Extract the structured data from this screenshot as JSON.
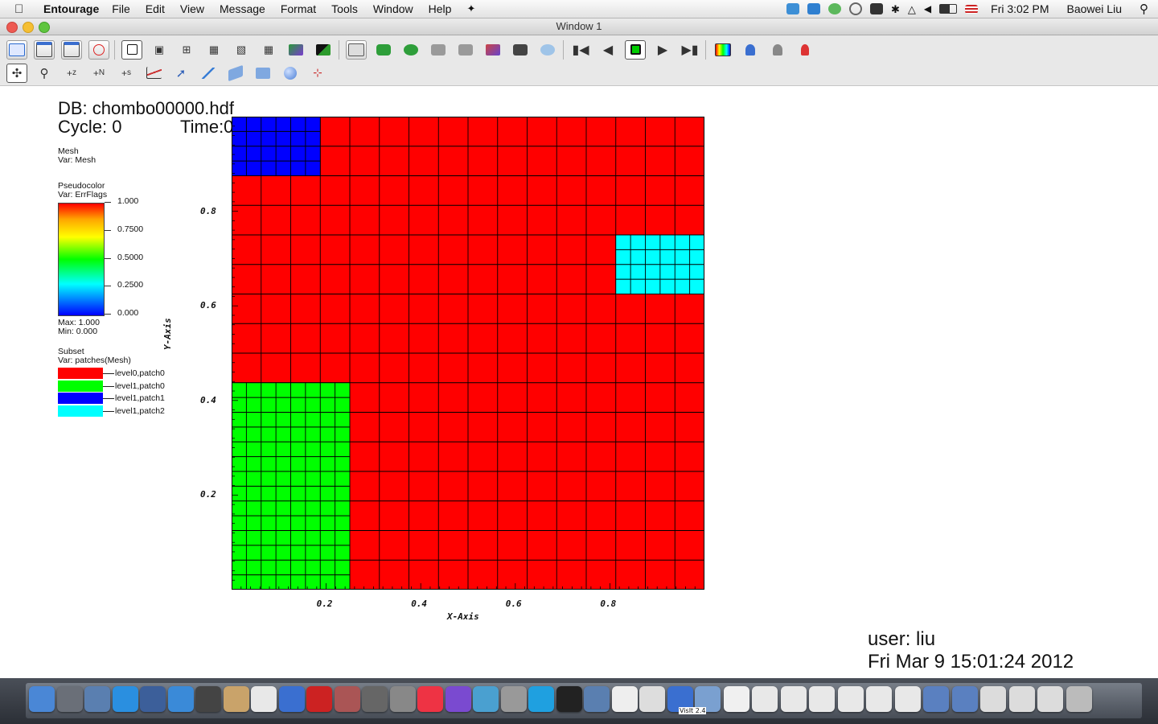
{
  "menubar": {
    "app_name": "Entourage",
    "items": [
      "File",
      "Edit",
      "View",
      "Message",
      "Format",
      "Tools",
      "Window",
      "Help"
    ],
    "clock": "Fri 3:02 PM",
    "user": "Baowei Liu",
    "icons": [
      "apple-icon",
      "dropbox-icon",
      "bluetooth-app-icon",
      "evernote-icon",
      "time-machine-icon",
      "binoculars-icon",
      "bluetooth-icon",
      "wifi-icon",
      "volume-icon",
      "battery-icon",
      "flag-us-icon",
      "spotlight-icon"
    ]
  },
  "window": {
    "title": "Window 1"
  },
  "toolbar": {
    "row1": [
      "checklist-icon",
      "new-window-icon",
      "copy-window-icon",
      "clear-window-icon",
      "layout-1x1-icon",
      "layout-1x2-icon",
      "layout-2x2-icon",
      "layout-2x3-icon",
      "layout-2x4-icon",
      "layout-3x3-icon",
      "invert-background-icon",
      "lock-view-icon",
      "box-view-icon",
      "reset-view-icon",
      "recenter-icon",
      "undo-view-icon",
      "redo-view-icon",
      "save-image-icon",
      "camera-icon",
      "spin-icon",
      "goto-first-icon",
      "reverse-step-icon",
      "stop-icon",
      "play-icon",
      "forward-step-icon",
      "color-table-icon",
      "plot-attr-icon",
      "operator-attr-icon",
      "clear-plots-icon"
    ],
    "row2": [
      "navigate-icon",
      "zoom-icon",
      "zone-pick-icon",
      "node-pick-icon",
      "spreadsheet-pick-icon",
      "lineout-icon",
      "pick-icon",
      "line-tool-icon",
      "plane-tool-icon",
      "box-tool-icon",
      "sphere-tool-icon",
      "slider-tool-icon"
    ]
  },
  "viz": {
    "db_label": "DB: chombo00000.hdf",
    "cycle_label": "Cycle: 0",
    "time_label": "Time:0",
    "mesh_title": "Mesh",
    "mesh_var": "Var: Mesh",
    "pc_title": "Pseudocolor",
    "pc_var": "Var: ErrFlags",
    "cb_labels": [
      "1.000",
      "0.7500",
      "0.5000",
      "0.2500",
      "0.000"
    ],
    "max_label": "Max:  1.000",
    "min_label": "Min:  0.000",
    "subset_title": "Subset",
    "subset_var": "Var: patches(Mesh)",
    "subsets": [
      {
        "label": "level0,patch0",
        "color": "#ff0000"
      },
      {
        "label": "level1,patch0",
        "color": "#00ff00"
      },
      {
        "label": "level1,patch1",
        "color": "#0000ff"
      },
      {
        "label": "level1,patch2",
        "color": "#00ffff"
      }
    ],
    "user_label": "user: liu",
    "date_label": "Fri Mar  9 15:01:24 2012"
  },
  "chart_data": {
    "type": "heatmap",
    "xlabel": "X-Axis",
    "ylabel": "Y-Axis",
    "xlim": [
      0,
      1
    ],
    "ylim": [
      0,
      1
    ],
    "x_ticks": [
      0.2,
      0.4,
      0.6,
      0.8
    ],
    "y_ticks": [
      0.2,
      0.4,
      0.6,
      0.8
    ],
    "base_cells": 16,
    "patches": [
      {
        "name": "level0,patch0",
        "x": [
          0,
          1
        ],
        "y": [
          0,
          1
        ],
        "color": "#ff0000",
        "cells": 16
      },
      {
        "name": "level1,patch0",
        "x": [
          0,
          0.25
        ],
        "y": [
          0,
          0.4375
        ],
        "color": "#00ff00",
        "cells": 32
      },
      {
        "name": "level1,patch1",
        "x": [
          0,
          0.1875
        ],
        "y": [
          0.875,
          1
        ],
        "color": "#0000ff",
        "cells": 32
      },
      {
        "name": "level1,patch2",
        "x": [
          0.8125,
          1
        ],
        "y": [
          0.625,
          0.75
        ],
        "color": "#00ffff",
        "cells": 32
      }
    ]
  },
  "dock": {
    "apps": [
      "finder-icon",
      "launchpad-icon",
      "preview-icon",
      "app-store-icon",
      "mail-bird-icon",
      "safari-icon",
      "facetime-icon",
      "address-book-icon",
      "calendar-icon",
      "itunes-icon",
      "photo-booth-icon",
      "iphoto-icon",
      "camera-icon",
      "system-preferences-icon",
      "chrome-icon",
      "eclipse-icon",
      "lw-icon",
      "utilities-icon",
      "skype-icon",
      "terminal-icon",
      "preview2-icon",
      "x11-icon",
      "textedit-icon",
      "visit-icon",
      "folder-icon",
      "document-icon",
      "document2-icon",
      "document3-icon",
      "document4-icon",
      "document5-icon",
      "document6-icon",
      "document7-icon",
      "screenshot-icon",
      "screenshot2-icon",
      "window-icon",
      "window2-icon",
      "window3-icon",
      "trash-icon"
    ],
    "visit_label": "VisIt 2.4"
  }
}
